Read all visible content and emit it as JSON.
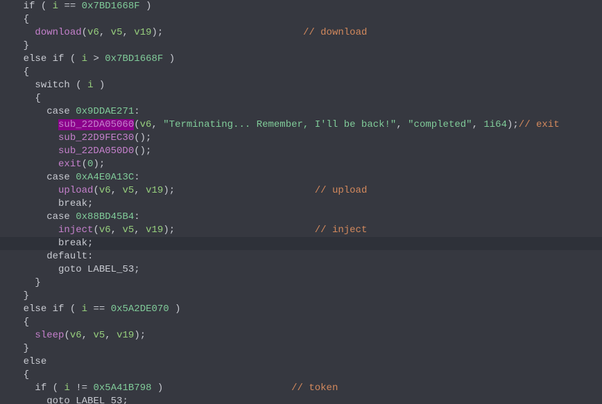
{
  "code": {
    "l01_kw_if": "if",
    "l01_var_i": "i",
    "l01_eq": "==",
    "l01_hex": "0x7BD1668F",
    "l02_brace": "{",
    "l03_call": "download",
    "l03_v6": "v6",
    "l03_v5": "v5",
    "l03_v19": "v19",
    "l03_comment": "// download",
    "l04_brace": "}",
    "l05_kw_else": "else",
    "l05_kw_if": "if",
    "l05_var_i": "i",
    "l05_gt": ">",
    "l05_hex": "0x7BD1668F",
    "l06_brace": "{",
    "l07_kw_switch": "switch",
    "l07_var_i": "i",
    "l08_brace": "{",
    "l09_kw_case": "case",
    "l09_hex": "0x9DDAE271",
    "l10_call": "sub_22DA05060",
    "l10_v6": "v6",
    "l10_str1": "\"Terminating... Remember, I'll be back!\"",
    "l10_str2": "\"completed\"",
    "l10_arg4": "1i64",
    "l10_comment": "// exit",
    "l11_call": "sub_22D9FEC30",
    "l12_call": "sub_22DA050D0",
    "l13_call": "exit",
    "l13_num": "0",
    "l14_kw_case": "case",
    "l14_hex": "0xA4E0A13C",
    "l15_call": "upload",
    "l15_v6": "v6",
    "l15_v5": "v5",
    "l15_v19": "v19",
    "l15_comment": "// upload",
    "l16_kw_break": "break",
    "l17_kw_case": "case",
    "l17_hex": "0x88BD45B4",
    "l18_call": "inject",
    "l18_v6": "v6",
    "l18_v5": "v5",
    "l18_v19": "v19",
    "l18_comment": "// inject",
    "l19_kw_break": "break",
    "l20_kw_default": "default",
    "l21_kw_goto": "goto",
    "l21_label": "LABEL_53",
    "l22_brace": "}",
    "l23_brace": "}",
    "l24_kw_else": "else",
    "l24_kw_if": "if",
    "l24_var_i": "i",
    "l24_eq": "==",
    "l24_hex": "0x5A2DE070",
    "l25_brace": "{",
    "l26_call": "sleep",
    "l26_v6": "v6",
    "l26_v5": "v5",
    "l26_v19": "v19",
    "l27_brace": "}",
    "l28_kw_else": "else",
    "l29_brace": "{",
    "l30_kw_if": "if",
    "l30_var_i": "i",
    "l30_neq": "!=",
    "l30_hex": "0x5A41B798",
    "l30_comment": "// token",
    "l31_kw_goto": "goto",
    "l31_label": "LABEL_53"
  }
}
